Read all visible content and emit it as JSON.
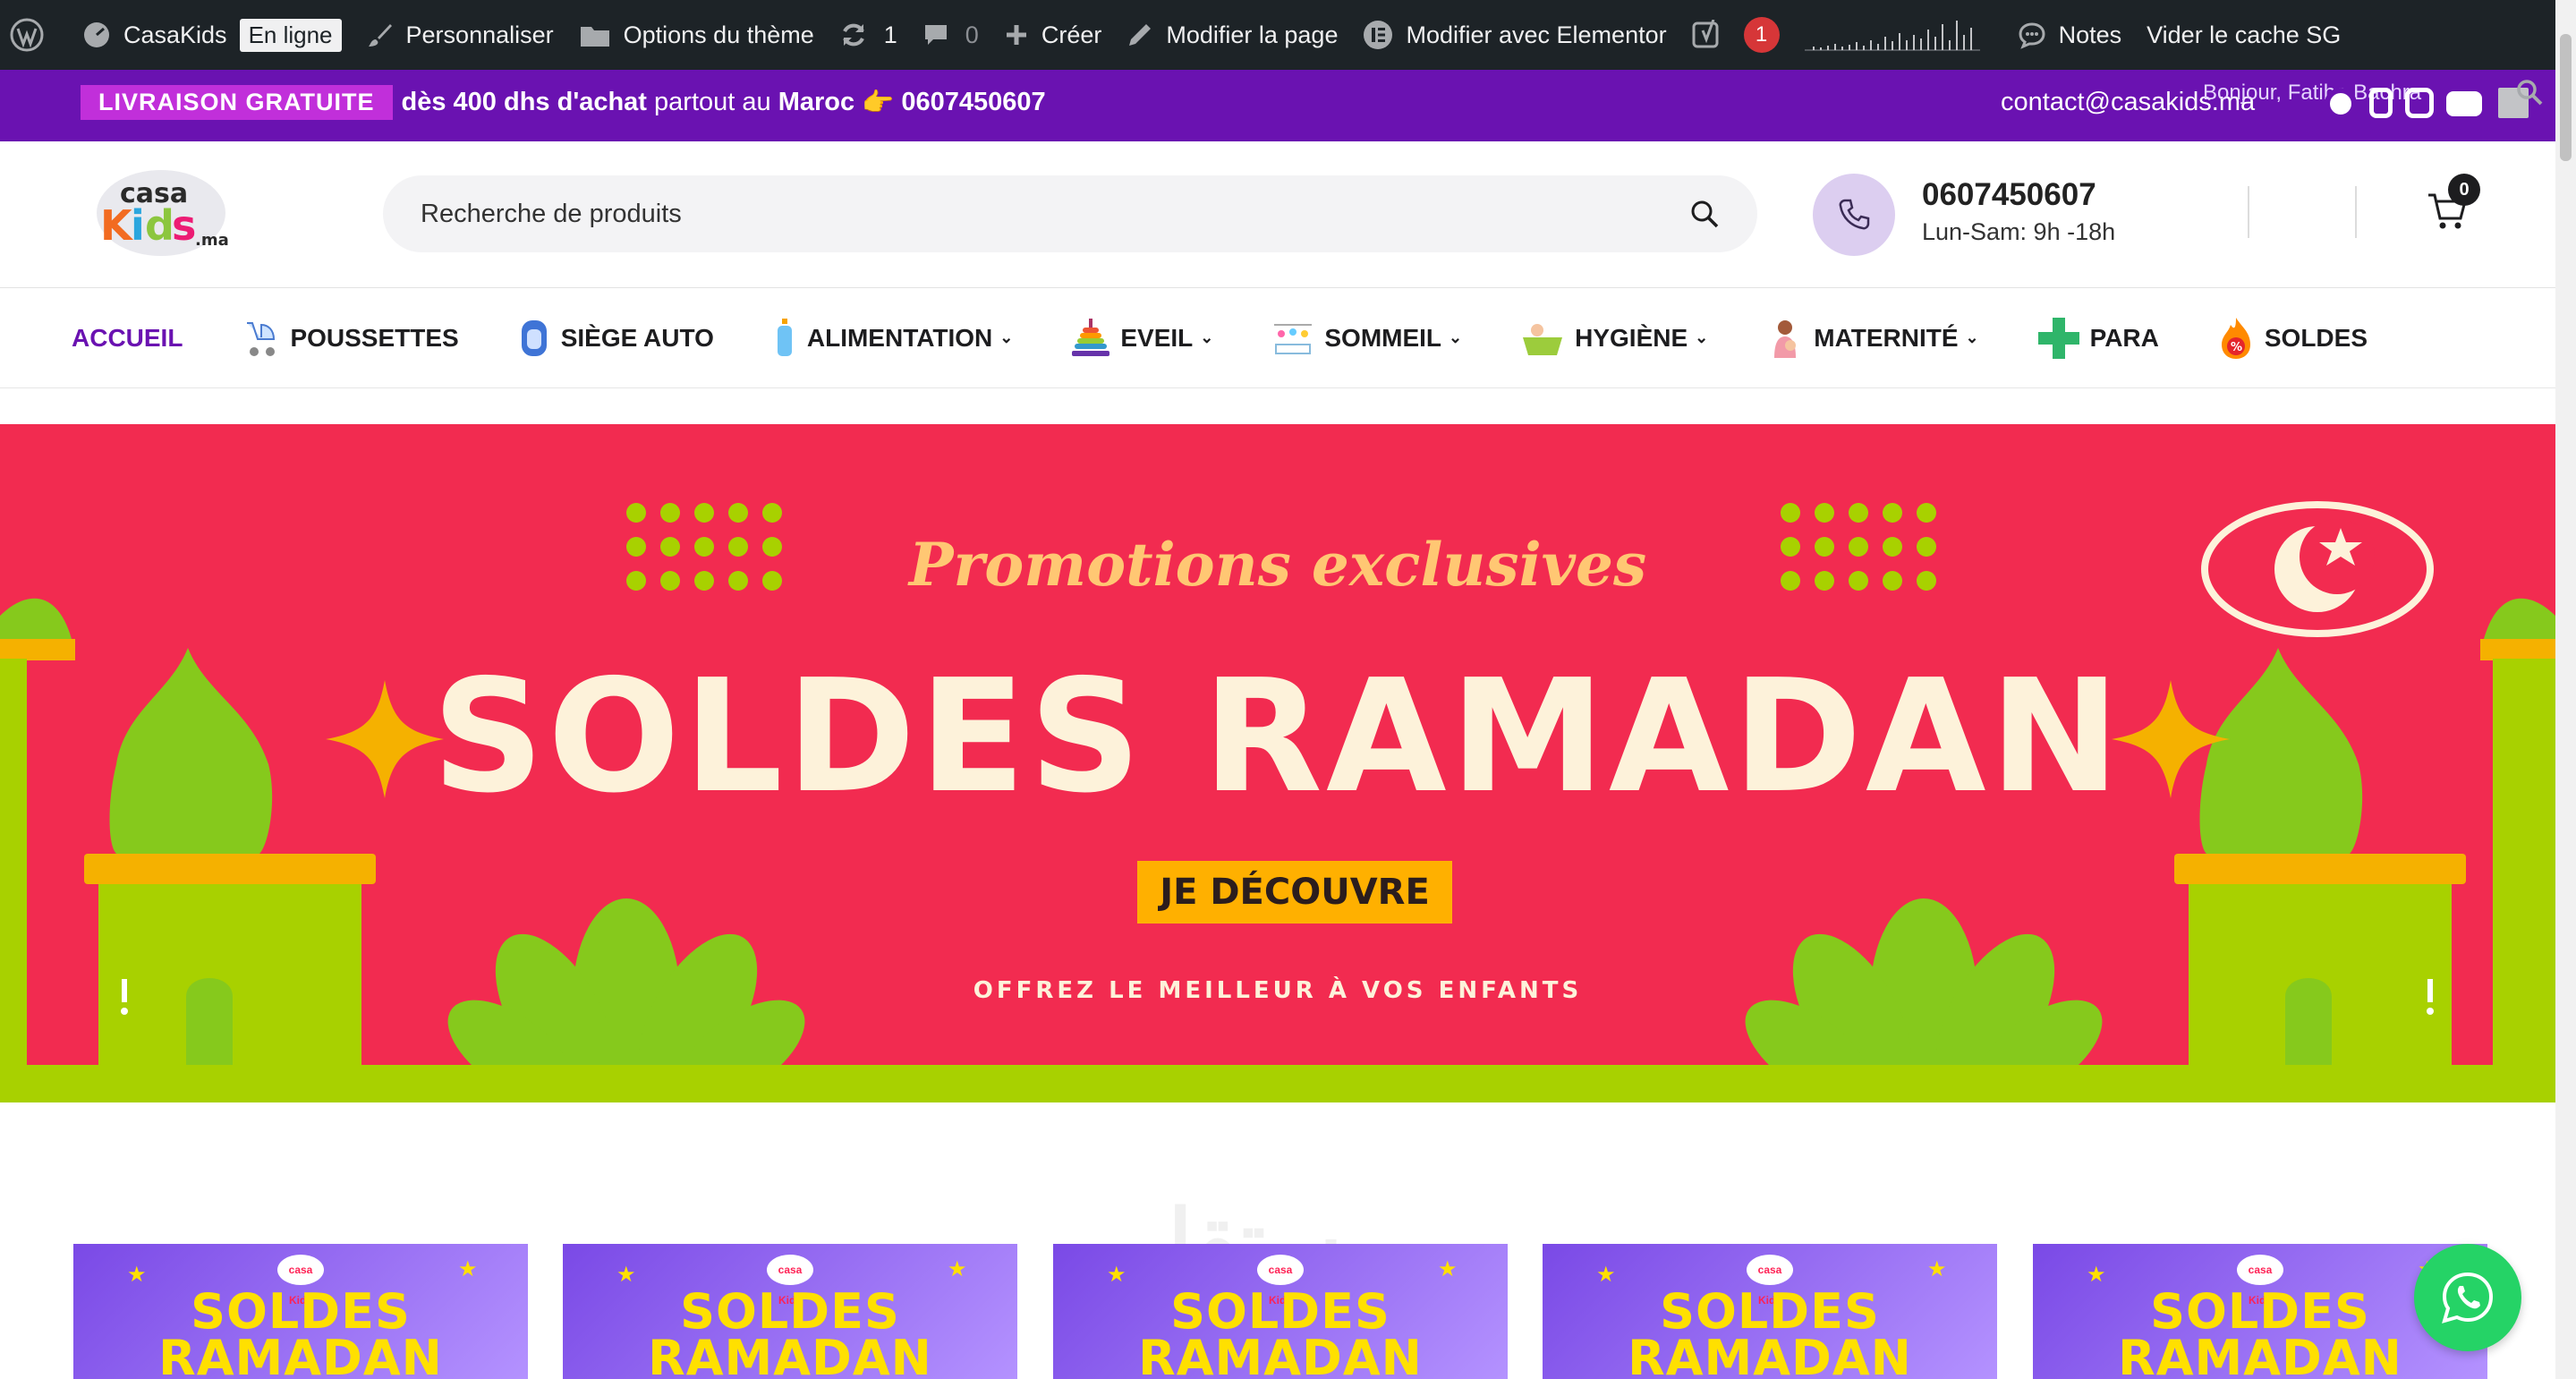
{
  "admin_bar": {
    "site_name": "CasaKids",
    "status_badge": "En ligne",
    "customize": "Personnaliser",
    "theme_options": "Options du thème",
    "updates_count": "1",
    "comments_count": "0",
    "create": "Créer",
    "edit_page": "Modifier la page",
    "edit_elementor": "Modifier avec Elementor",
    "yoast_count": "1",
    "notes": "Notes",
    "clear_cache": "Vider le cache SG",
    "greeting": "Bonjour, Fatiha Bachra"
  },
  "top_bar": {
    "free_delivery_tag": "LIVRAISON GRATUITE",
    "promo_bold": "dès 400 dhs d'achat",
    "promo_mid": "partout au",
    "promo_country": "Maroc",
    "promo_emoji": "👉",
    "promo_phone": "0607450607",
    "contact_email": "contact@casakids.ma"
  },
  "header": {
    "logo_text_top": "casa",
    "logo_text_main": "Kids",
    "logo_text_suffix": ".ma",
    "search_placeholder": "Recherche de produits",
    "phone": "0607450607",
    "hours": "Lun-Sam: 9h -18h",
    "cart_count": "0"
  },
  "nav": {
    "items": [
      {
        "label": "ACCUEIL"
      },
      {
        "label": "POUSSETTES"
      },
      {
        "label": "SIÈGE AUTO"
      },
      {
        "label": "ALIMENTATION"
      },
      {
        "label": "EVEIL"
      },
      {
        "label": "SOMMEIL"
      },
      {
        "label": "HYGIÈNE"
      },
      {
        "label": "MATERNITÉ"
      },
      {
        "label": "PARA"
      },
      {
        "label": "SOLDES"
      }
    ]
  },
  "banner": {
    "subtitle": "Promotions exclusives",
    "title": "SOLDES RAMADAN",
    "cta": "JE DÉCOUVRE",
    "tagline": "OFFREZ LE MEILLEUR À VOS ENFANTS"
  },
  "cards": {
    "logo": "casa Kids",
    "line1": "SOLDES",
    "line2": "RAMADAN"
  },
  "colors": {
    "brand_purple": "#6a12b1",
    "banner_red": "#f22b50",
    "banner_green": "#a8d100",
    "cta_yellow": "#ffb000",
    "whatsapp_green": "#25d366"
  }
}
